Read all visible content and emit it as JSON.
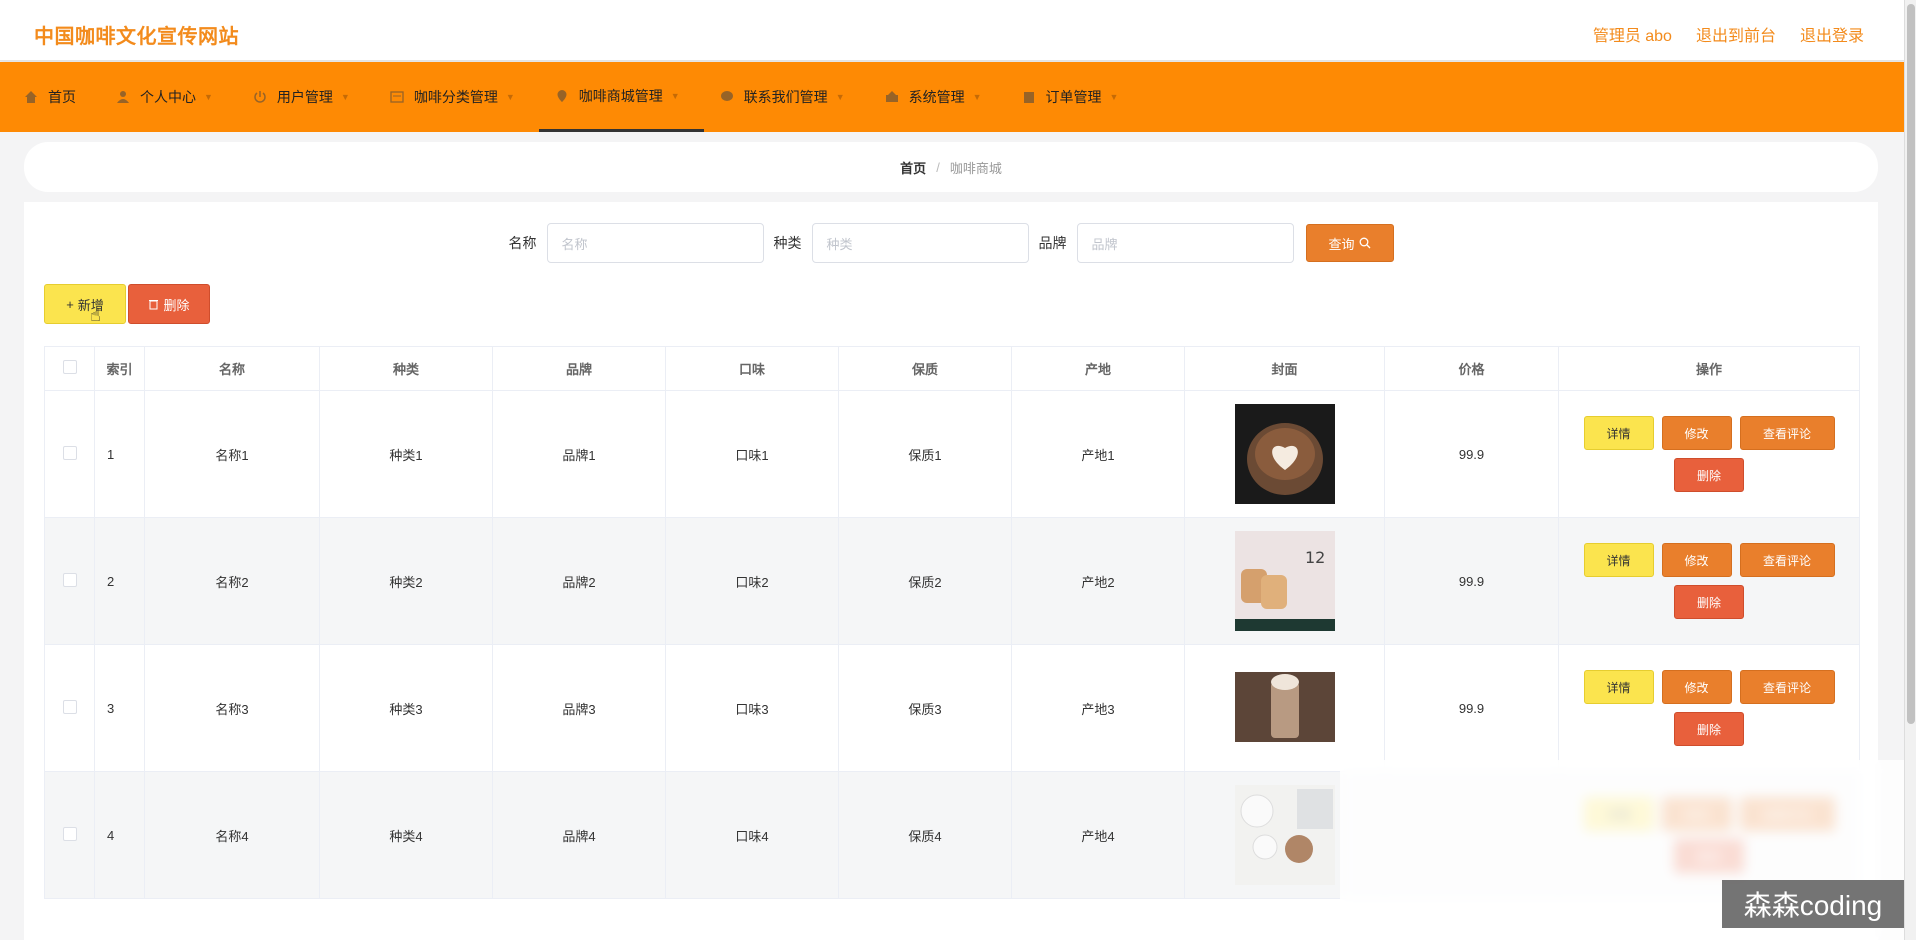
{
  "header": {
    "site_title": "中国咖啡文化宣传网站",
    "admin_label": "管理员 abo",
    "front_link": "退出到前台",
    "logout_link": "退出登录"
  },
  "nav": [
    {
      "label": "首页",
      "icon": "home-icon"
    },
    {
      "label": "个人中心",
      "icon": "user-icon"
    },
    {
      "label": "用户管理",
      "icon": "power-icon"
    },
    {
      "label": "咖啡分类管理",
      "icon": "category-icon"
    },
    {
      "label": "咖啡商城管理",
      "icon": "location-icon"
    },
    {
      "label": "联系我们管理",
      "icon": "chat-icon"
    },
    {
      "label": "系统管理",
      "icon": "system-icon"
    },
    {
      "label": "订单管理",
      "icon": "order-icon"
    }
  ],
  "breadcrumb": {
    "home": "首页",
    "separator": "/",
    "current": "咖啡商城"
  },
  "search": {
    "name_label": "名称",
    "name_placeholder": "名称",
    "type_label": "种类",
    "type_placeholder": "种类",
    "brand_label": "品牌",
    "brand_placeholder": "品牌",
    "query_button": "查询"
  },
  "actions": {
    "add": "新增",
    "delete": "删除"
  },
  "table": {
    "headers": [
      "索引",
      "名称",
      "种类",
      "品牌",
      "口味",
      "保质",
      "产地",
      "封面",
      "价格",
      "操作"
    ],
    "rows": [
      {
        "index": "1",
        "name": "名称1",
        "type": "种类1",
        "brand": "品牌1",
        "taste": "口味1",
        "shelf": "保质1",
        "origin": "产地1",
        "price": "99.9"
      },
      {
        "index": "2",
        "name": "名称2",
        "type": "种类2",
        "brand": "品牌2",
        "taste": "口味2",
        "shelf": "保质2",
        "origin": "产地2",
        "price": "99.9"
      },
      {
        "index": "3",
        "name": "名称3",
        "type": "种类3",
        "brand": "品牌3",
        "taste": "口味3",
        "shelf": "保质3",
        "origin": "产地3",
        "price": "99.9"
      },
      {
        "index": "4",
        "name": "名称4",
        "type": "种类4",
        "brand": "品牌4",
        "taste": "口味4",
        "shelf": "保质4",
        "origin": "产地4",
        "price": ""
      }
    ],
    "op_labels": {
      "detail": "详情",
      "edit": "修改",
      "review": "查看评论",
      "delete": "删除"
    }
  },
  "watermark": "森森coding",
  "colors": {
    "primary": "#fe8a04",
    "accent": "#f38b1c",
    "yellow": "#fbe44e",
    "red": "#e8603c"
  }
}
